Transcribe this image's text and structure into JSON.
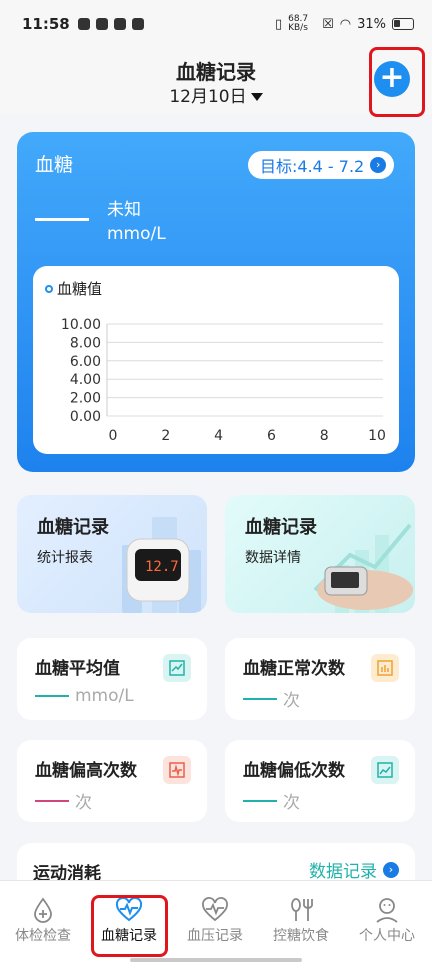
{
  "status": {
    "time": "11:58",
    "speed": "68.7 KB/s",
    "battery": "31%"
  },
  "header": {
    "title": "血糖记录",
    "date": "12月10日"
  },
  "glucose_card": {
    "label": "血糖",
    "target": "目标:4.4 - 7.2",
    "value_status": "未知",
    "unit": "mmo/L",
    "legend": "血糖值"
  },
  "chart_data": {
    "type": "line",
    "series": [
      {
        "name": "血糖值",
        "values": []
      }
    ],
    "x_ticks": [
      "0",
      "2",
      "4",
      "6",
      "8",
      "10"
    ],
    "y_ticks": [
      "10.00",
      "8.00",
      "6.00",
      "4.00",
      "2.00",
      "0.00"
    ],
    "xlim": [
      0,
      10
    ],
    "ylim": [
      0,
      10
    ],
    "grid": true,
    "legend": "top-left"
  },
  "quick_cards": [
    {
      "title": "血糖记录",
      "subtitle": "统计报表"
    },
    {
      "title": "血糖记录",
      "subtitle": "数据详情"
    }
  ],
  "stats": [
    {
      "title": "血糖平均值",
      "value": "mmo/L",
      "color": "#20b2aa"
    },
    {
      "title": "血糖正常次数",
      "value": "次",
      "color": "#20b2aa"
    },
    {
      "title": "血糖偏高次数",
      "value": "次",
      "color": "#d0457a"
    },
    {
      "title": "血糖偏低次数",
      "value": "次",
      "color": "#20b2aa"
    }
  ],
  "exercise": {
    "title": "运动消耗",
    "link": "数据记录"
  },
  "tabs": [
    {
      "label": "体检检查"
    },
    {
      "label": "血糖记录"
    },
    {
      "label": "血压记录"
    },
    {
      "label": "控糖饮食"
    },
    {
      "label": "个人中心"
    }
  ],
  "colors": {
    "accent": "#1e8ff0",
    "teal": "#20b2aa",
    "highlight": "#e0161f"
  }
}
